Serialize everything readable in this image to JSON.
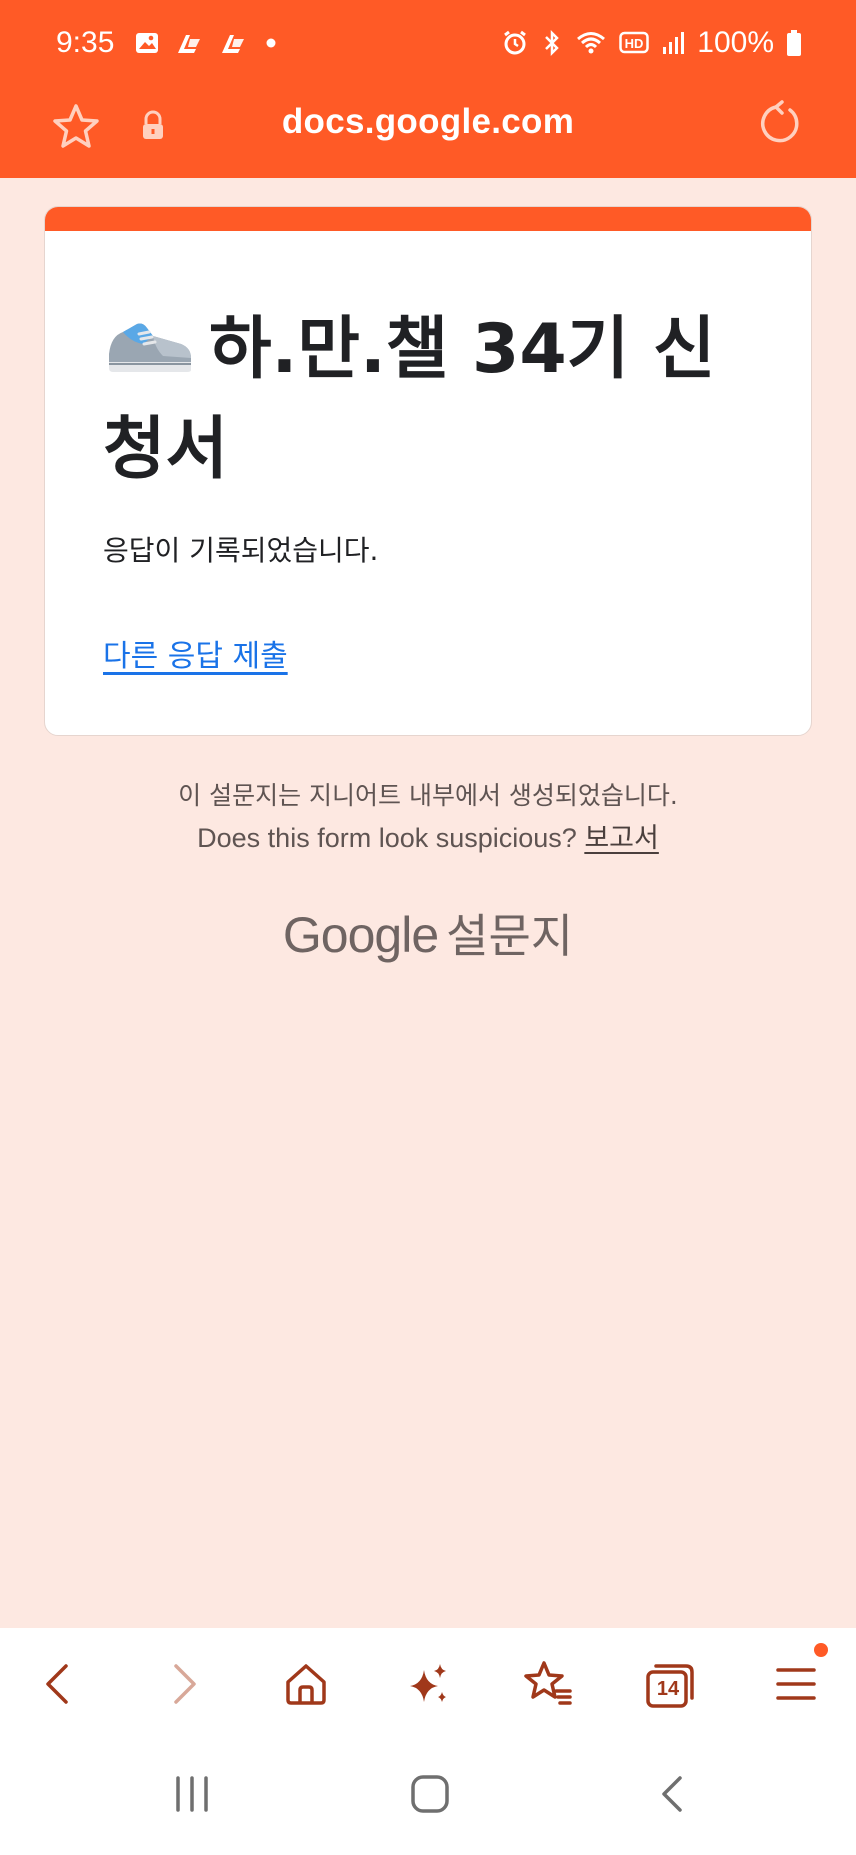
{
  "status_bar": {
    "time": "9:35",
    "battery_percent": "100%",
    "icons": [
      "gallery-icon",
      "app-notification-icon",
      "app-notification-icon",
      "dot-icon",
      "alarm-icon",
      "bluetooth-icon",
      "wifi-icon",
      "hd-icon",
      "signal-icon",
      "battery-icon"
    ]
  },
  "url_bar": {
    "url": "docs.google.com",
    "icons": [
      "star-icon",
      "lock-icon",
      "reload-icon"
    ]
  },
  "form": {
    "title": "하.만.챌 34기 신청서",
    "message": "응답이 기록되었습니다.",
    "another_response_link": "다른 응답 제출"
  },
  "footer": {
    "internal_note": "이 설문지는 지니어트 내부에서 생성되었습니다.",
    "suspicious_prompt": "Does this form look suspicious?",
    "report_link": "보고서",
    "logo_google": "Google",
    "logo_forms": "설문지"
  },
  "toolbar": {
    "tab_count": "14",
    "icons": [
      "back-icon",
      "forward-icon",
      "home-icon",
      "sparkle-icon",
      "bookmarks-icon",
      "tabs-icon",
      "menu-icon"
    ]
  },
  "colors": {
    "accent": "#ff5a26",
    "background": "#fde8e1",
    "link": "#1a73e8",
    "toolbar_icon": "#a0381a"
  }
}
